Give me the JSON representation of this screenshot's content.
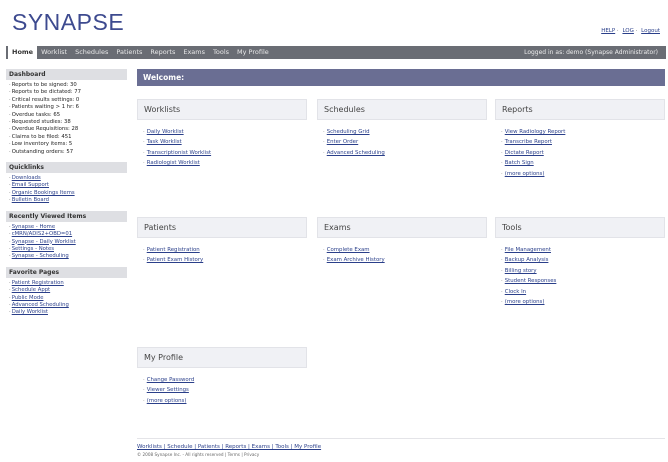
{
  "header": {
    "logo": "SYNAPSE",
    "links": [
      "HELP",
      "LOG",
      "Logout"
    ]
  },
  "nav": {
    "tabs": [
      "Home",
      "Worklist",
      "Schedules",
      "Patients",
      "Reports",
      "Exams",
      "Tools",
      "My Profile"
    ],
    "login_text": "Logged in as: demo (Synapse Administrator)"
  },
  "sidebar": {
    "dashboard": {
      "title": "Dashboard",
      "items": [
        "Reports to be signed: 30",
        "Reports to be dictated: 77",
        "Critical results settings: 0",
        "Patients waiting > 1 hr: 6",
        "Overdue tasks: 65",
        "Requested studies: 38",
        "Overdue Requisitions: 28",
        "Claims to be filed: 451",
        "Low inventory items: 5",
        "Outstanding orders: 57"
      ]
    },
    "quicklinks": {
      "title": "Quicklinks",
      "items": [
        "Downloads",
        "Email Support",
        "Organic Bookings Items",
        "Bulletin Board"
      ]
    },
    "recent": {
      "title": "Recently Viewed Items",
      "items": [
        "Synapse - Home",
        "cMRN/ADIS2+OBD=01",
        "Synapse - Daily Worklist",
        "Settings - Notes",
        "Synapse - Scheduling"
      ]
    },
    "favorites": {
      "title": "Favorite Pages",
      "items": [
        "Patient Registration",
        "Schedule Appt",
        "Public Mode",
        "Advanced Scheduling",
        "Daily Worklist"
      ]
    }
  },
  "main": {
    "welcome": "Welcome:",
    "panels": {
      "worklists": {
        "title": "Worklists",
        "items": [
          "Daily Worklist",
          "Task Worklist",
          "Transcriptionist Worklist",
          "Radiologist Worklist"
        ]
      },
      "schedules": {
        "title": "Schedules",
        "items": [
          "Scheduling Grid",
          "Enter Order",
          "Advanced Scheduling"
        ]
      },
      "reports": {
        "title": "Reports",
        "items": [
          "View Radiology Report",
          "Transcribe Report",
          "Dictate Report",
          "Batch Sign",
          "(more options)"
        ]
      },
      "patients": {
        "title": "Patients",
        "items": [
          "Patient Registration",
          "Patient Exam History"
        ]
      },
      "exams": {
        "title": "Exams",
        "items": [
          "Complete Exam",
          "Exam Archive History"
        ]
      },
      "tools": {
        "title": "Tools",
        "items": [
          "File Management",
          "Backup Analysis",
          "Billing story",
          "Student Responses",
          "Clock In",
          "(more options)"
        ]
      },
      "profile": {
        "title": "My Profile",
        "items": [
          "Change Password",
          "Viewer Settings",
          "(more options)"
        ]
      }
    }
  },
  "footer": {
    "links": "Worklists | Schedule | Patients | Reports | Exams | Tools | My Profile",
    "copyright": "© 2008 Synapse Inc. - All rights reserved | Terms | Privacy"
  }
}
